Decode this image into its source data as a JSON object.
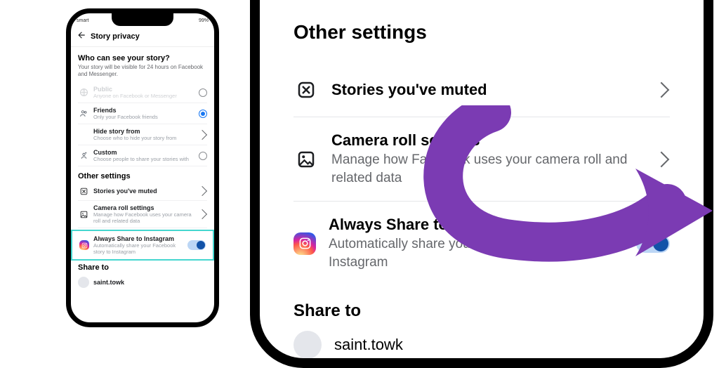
{
  "status": {
    "left": "smart",
    "right": "99%"
  },
  "topbar": {
    "title": "Story privacy"
  },
  "section1": {
    "heading": "Who can see your story?",
    "subtitle": "Your story will be visible for 24 hours on Facebook and Messenger.",
    "options": {
      "public": {
        "title": "Public",
        "desc": "Anyone on Facebook or Messenger"
      },
      "friends": {
        "title": "Friends",
        "desc": "Only your Facebook friends"
      },
      "hide": {
        "title": "Hide story from",
        "desc": "Choose who to hide your story from"
      },
      "custom": {
        "title": "Custom",
        "desc": "Choose people to share your stories with"
      }
    }
  },
  "other": {
    "heading": "Other settings",
    "muted": {
      "title": "Stories you've muted"
    },
    "camera": {
      "title": "Camera roll settings",
      "desc": "Manage how Facebook uses your camera roll and related data"
    },
    "ig": {
      "title": "Always Share to Instagram",
      "desc": "Automatically share your Facebook story to Instagram"
    }
  },
  "shareto": {
    "heading": "Share to",
    "user": "saint.towk"
  }
}
